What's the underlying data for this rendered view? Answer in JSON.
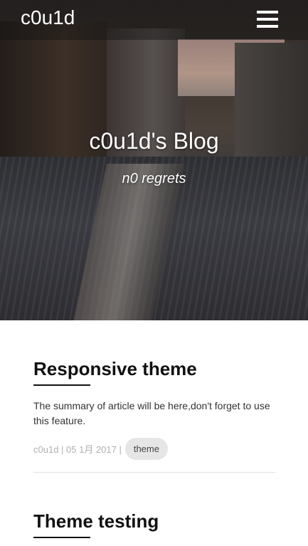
{
  "navbar": {
    "brand": "c0u1d",
    "menu_icon": "hamburger-menu-icon"
  },
  "hero": {
    "title": "c0u1d's Blog",
    "subtitle": "n0 regrets"
  },
  "posts": [
    {
      "title": "Responsive theme",
      "summary": "The summary of article will be here,don't forget to use this feature.",
      "meta": "c0u1d | 05 1月 2017 |",
      "tag": "theme"
    },
    {
      "title": "Theme testing"
    }
  ]
}
